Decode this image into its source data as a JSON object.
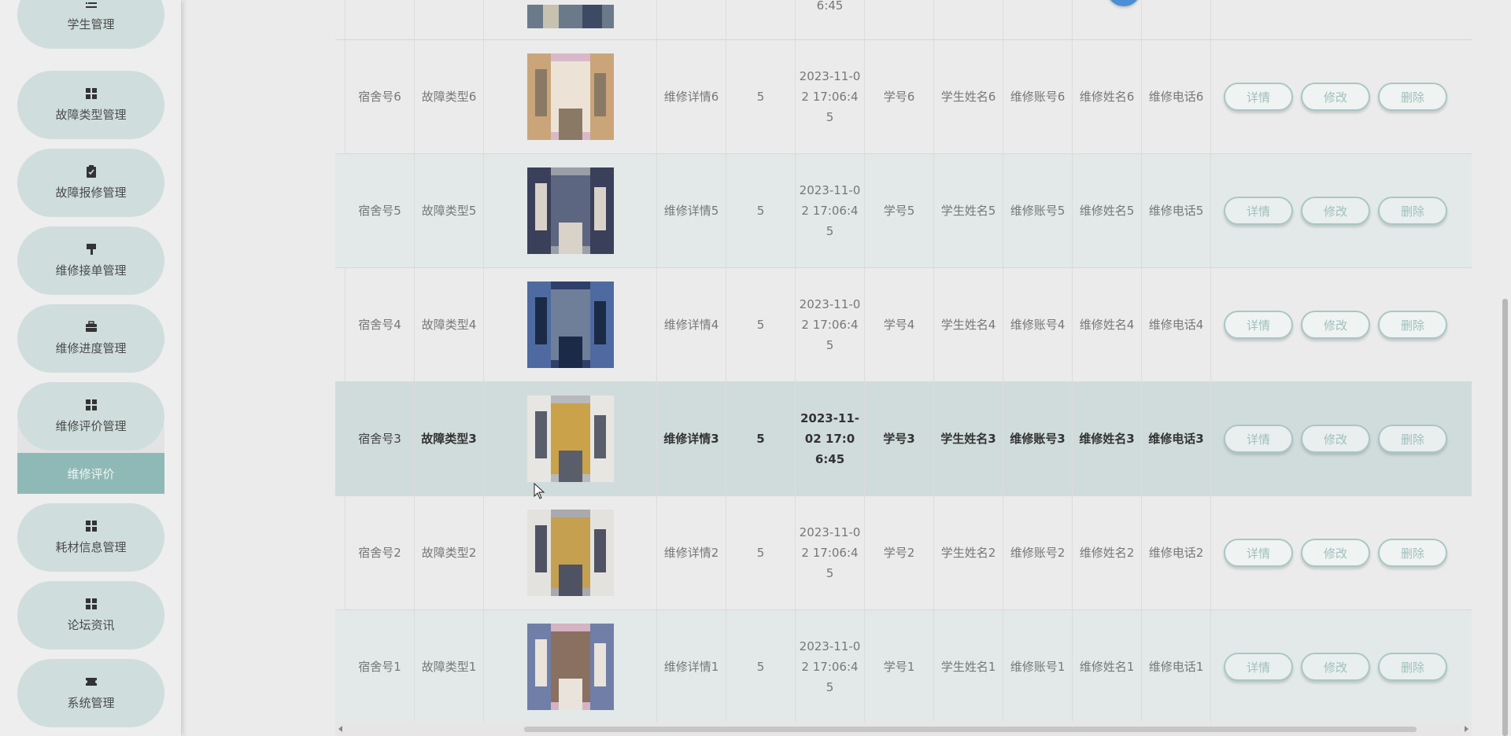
{
  "sidebar": {
    "items": [
      {
        "label": "学生管理",
        "icon": "list-icon"
      },
      {
        "label": "故障类型管理",
        "icon": "grid-icon"
      },
      {
        "label": "故障报修管理",
        "icon": "clipboard-check-icon"
      },
      {
        "label": "维修接单管理",
        "icon": "brush-icon"
      },
      {
        "label": "维修进度管理",
        "icon": "briefcase-icon"
      },
      {
        "label": "维修评价管理",
        "icon": "grid-icon"
      },
      {
        "label": "耗材信息管理",
        "icon": "grid-icon"
      },
      {
        "label": "论坛资讯",
        "icon": "grid-icon"
      },
      {
        "label": "系统管理",
        "icon": "ticket-icon"
      }
    ],
    "active_submenu": "维修评价"
  },
  "table": {
    "partial_top_row": {
      "time_tail": "6:45"
    },
    "rows": [
      {
        "dorm": "宿舍号6",
        "fault_type": "故障类型6",
        "detail": "维修详情6",
        "score": "5",
        "time": "2023-11-02 17:06:45",
        "student_no": "学号6",
        "student_name": "学生姓名6",
        "repair_account": "维修账号6",
        "repair_name": "维修姓名6",
        "repair_phone": "维修电话6"
      },
      {
        "dorm": "宿舍号5",
        "fault_type": "故障类型5",
        "detail": "维修详情5",
        "score": "5",
        "time": "2023-11-02 17:06:45",
        "student_no": "学号5",
        "student_name": "学生姓名5",
        "repair_account": "维修账号5",
        "repair_name": "维修姓名5",
        "repair_phone": "维修电话5"
      },
      {
        "dorm": "宿舍号4",
        "fault_type": "故障类型4",
        "detail": "维修详情4",
        "score": "5",
        "time": "2023-11-02 17:06:45",
        "student_no": "学号4",
        "student_name": "学生姓名4",
        "repair_account": "维修账号4",
        "repair_name": "维修姓名4",
        "repair_phone": "维修电话4"
      },
      {
        "dorm": "宿舍号3",
        "fault_type": "故障类型3",
        "detail": "维修详情3",
        "score": "5",
        "time": "2023-11-02 17:06:45",
        "student_no": "学号3",
        "student_name": "学生姓名3",
        "repair_account": "维修账号3",
        "repair_name": "维修姓名3",
        "repair_phone": "维修电话3"
      },
      {
        "dorm": "宿舍号2",
        "fault_type": "故障类型2",
        "detail": "维修详情2",
        "score": "5",
        "time": "2023-11-02 17:06:45",
        "student_no": "学号2",
        "student_name": "学生姓名2",
        "repair_account": "维修账号2",
        "repair_name": "维修姓名2",
        "repair_phone": "维修电话2"
      },
      {
        "dorm": "宿舍号1",
        "fault_type": "故障类型1",
        "detail": "维修详情1",
        "score": "5",
        "time": "2023-11-02 17:06:45",
        "student_no": "学号1",
        "student_name": "学生姓名1",
        "repair_account": "维修账号1",
        "repair_name": "维修姓名1",
        "repair_phone": "维修电话1"
      }
    ],
    "actions": {
      "detail": "详情",
      "edit": "修改",
      "delete": "删除"
    }
  },
  "colors": {
    "accent": "#8fb9b6",
    "pill": "#cfdedc",
    "button_border": "#a9c7c4"
  }
}
